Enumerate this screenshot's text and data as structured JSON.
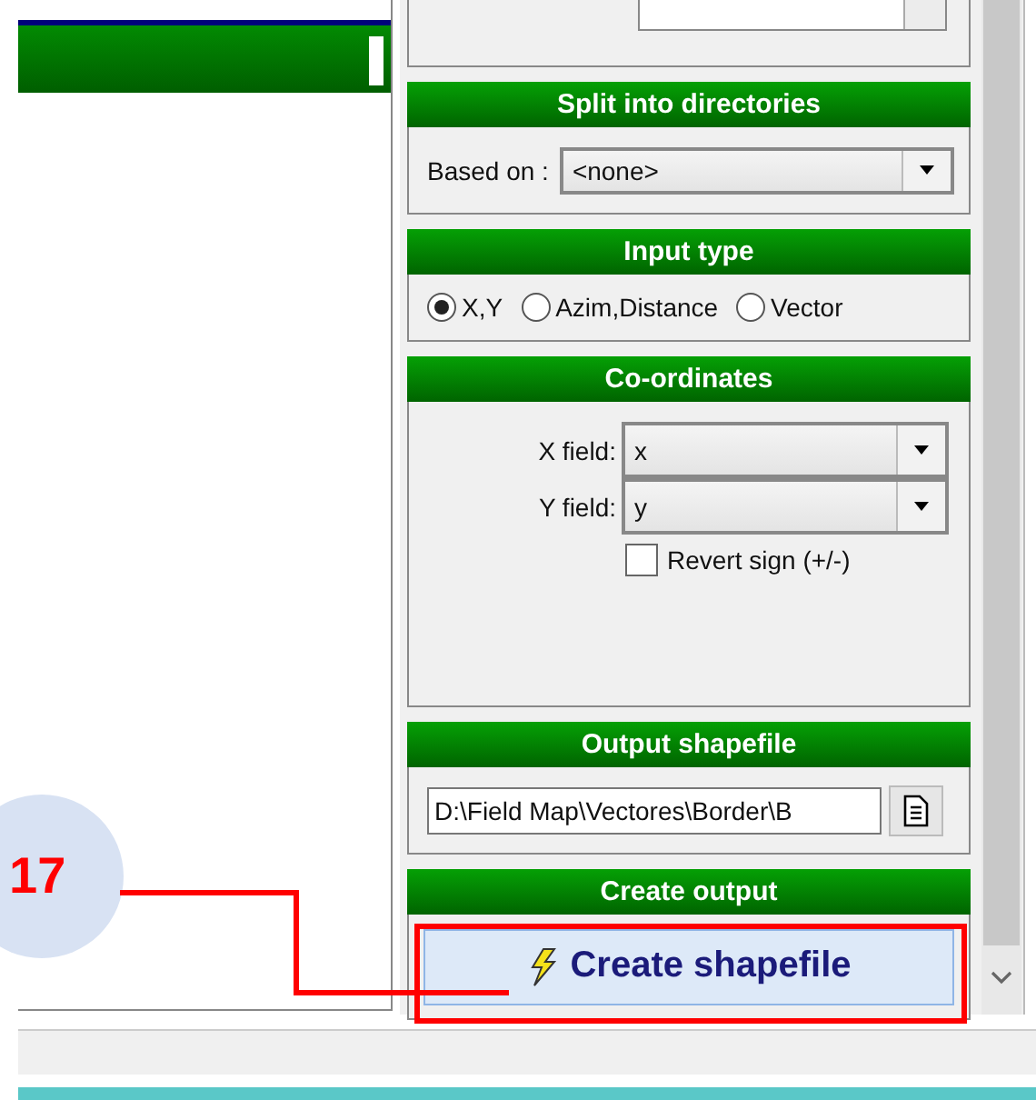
{
  "sections": [
    {
      "kind": "partial"
    },
    {
      "kind": "combo",
      "title": "Split into directories",
      "label": "Based on :",
      "value": "<none>"
    },
    {
      "kind": "radios",
      "title": "Input type",
      "options": [
        {
          "label": "X,Y",
          "selected": true
        },
        {
          "label": "Azim,Distance",
          "selected": false
        },
        {
          "label": "Vector",
          "selected": false
        }
      ]
    },
    {
      "kind": "coords",
      "title": "Co-ordinates",
      "fields": [
        {
          "label": "X field:",
          "value": "x"
        },
        {
          "label": "Y field:",
          "value": "y"
        }
      ],
      "checkbox": {
        "label": "Revert sign (+/-)",
        "checked": false
      }
    },
    {
      "kind": "path",
      "title": "Output shapefile",
      "value": "D:\\Field Map\\Vectores\\Border\\B"
    },
    {
      "kind": "action",
      "title": "Create output",
      "button": "Create shapefile"
    }
  ],
  "callout": {
    "number": "17"
  }
}
